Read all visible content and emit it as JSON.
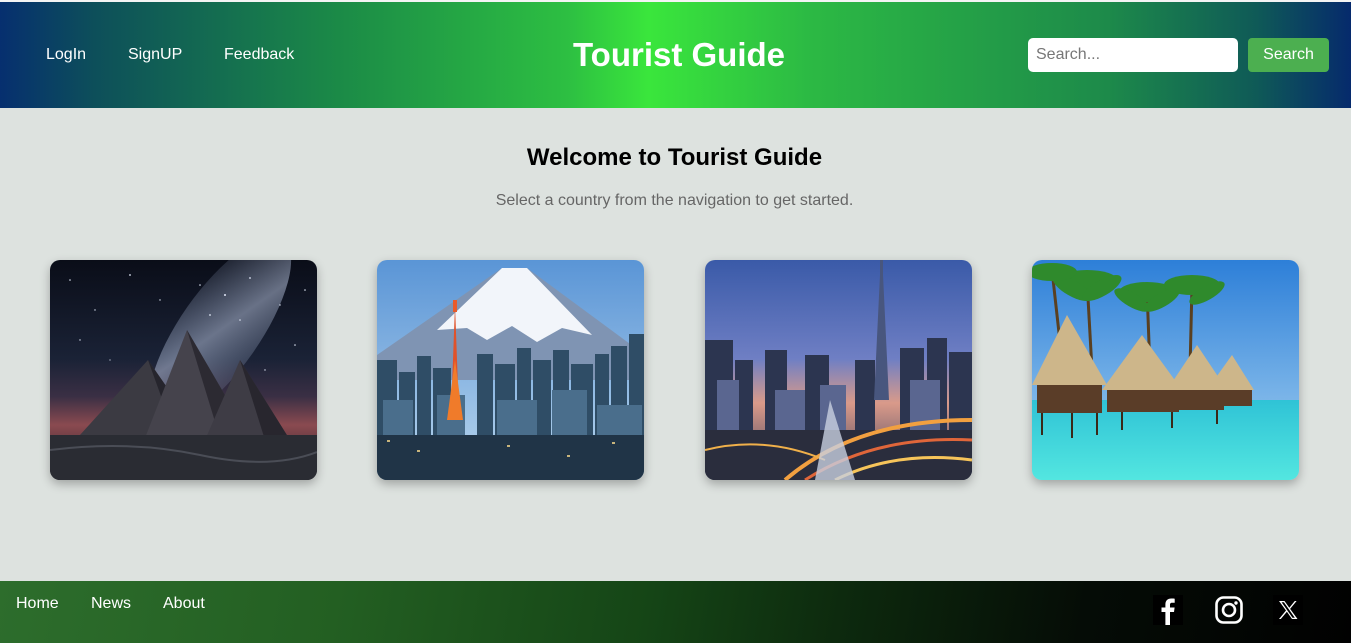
{
  "header": {
    "nav": [
      {
        "label": "LogIn"
      },
      {
        "label": "SignUP"
      },
      {
        "label": "Feedback"
      }
    ],
    "title": "Tourist Guide",
    "search": {
      "placeholder": "Search...",
      "value": "",
      "button_label": "Search"
    }
  },
  "main": {
    "heading": "Welcome to Tourist Guide",
    "subtitle": "Select a country from the navigation to get started.",
    "cards": [
      {
        "image": "pyramids-night-sky"
      },
      {
        "image": "mount-fuji-tokyo-tower"
      },
      {
        "image": "dubai-skyline"
      },
      {
        "image": "maldives-water-villas"
      }
    ]
  },
  "footer": {
    "links": [
      {
        "label": "Home"
      },
      {
        "label": "News"
      },
      {
        "label": "About"
      }
    ],
    "social": [
      {
        "icon": "facebook-icon"
      },
      {
        "icon": "instagram-icon"
      },
      {
        "icon": "x-icon"
      }
    ]
  },
  "colors": {
    "search_button": "#4caf50",
    "page_background": "#dde2df",
    "header_gradient_center": "#3ae63c",
    "header_gradient_edges": "#062f6f"
  }
}
